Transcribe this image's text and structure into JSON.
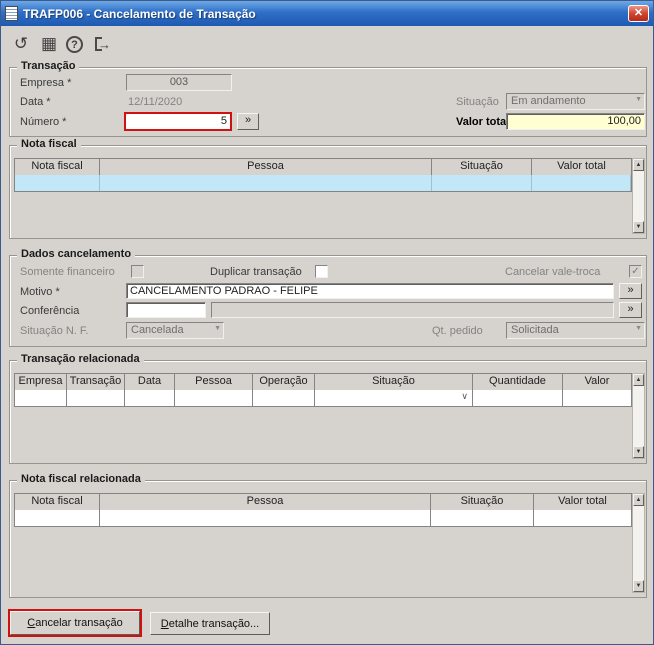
{
  "ui": {
    "close_glyph": "✕",
    "more_glyph": "»",
    "scroll_up_glyph": "▲",
    "scroll_down_glyph": "▼",
    "combo_arrow_glyph": "▼",
    "check_glyph": "✓",
    "cell_chevron_glyph": "∨"
  },
  "window": {
    "title": "TRAFP006 - Cancelamento de Transação"
  },
  "toolbar": {
    "refresh_glyph": "↺",
    "calendar_glyph": "▦",
    "help_glyph": "?",
    "exit_glyph": "→"
  },
  "transacao": {
    "legend": "Transação",
    "empresa_label": "Empresa *",
    "empresa_value": "003",
    "data_label": "Data *",
    "data_value": "12/11/2020",
    "situacao_label": "Situação",
    "situacao_value": "Em andamento",
    "numero_label": "Número *",
    "numero_value": "5",
    "valor_total_label": "Valor total",
    "valor_total_value": "100,00"
  },
  "nota_fiscal": {
    "legend": "Nota fiscal",
    "headers": [
      "Nota fiscal",
      "Pessoa",
      "Situação",
      "Valor total"
    ]
  },
  "dados_cancelamento": {
    "legend": "Dados cancelamento",
    "somente_financeiro_label": "Somente financeiro",
    "duplicar_label": "Duplicar transação",
    "cancelar_vale_troca_label": "Cancelar vale-troca",
    "motivo_label": "Motivo *",
    "motivo_value": "CANCELAMENTO PADRAO - FELIPE",
    "conferencia_label": "Conferência",
    "conferencia_value": "",
    "situacao_nf_label": "Situação N. F.",
    "situacao_nf_value": "Cancelada",
    "qt_pedido_label": "Qt. pedido",
    "qt_pedido_value": "Solicitada"
  },
  "transacao_relacionada": {
    "legend": "Transação relacionada",
    "headers": [
      "Empresa",
      "Transação",
      "Data",
      "Pessoa",
      "Operação",
      "Situação",
      "Quantidade",
      "Valor"
    ]
  },
  "nota_fiscal_relacionada": {
    "legend": "Nota fiscal relacionada",
    "headers": [
      "Nota fiscal",
      "Pessoa",
      "Situação",
      "Valor total"
    ]
  },
  "footer": {
    "cancelar_accel": "C",
    "cancelar_rest": "ancelar transação",
    "detalhe_accel": "D",
    "detalhe_rest": "etalhe transação..."
  }
}
